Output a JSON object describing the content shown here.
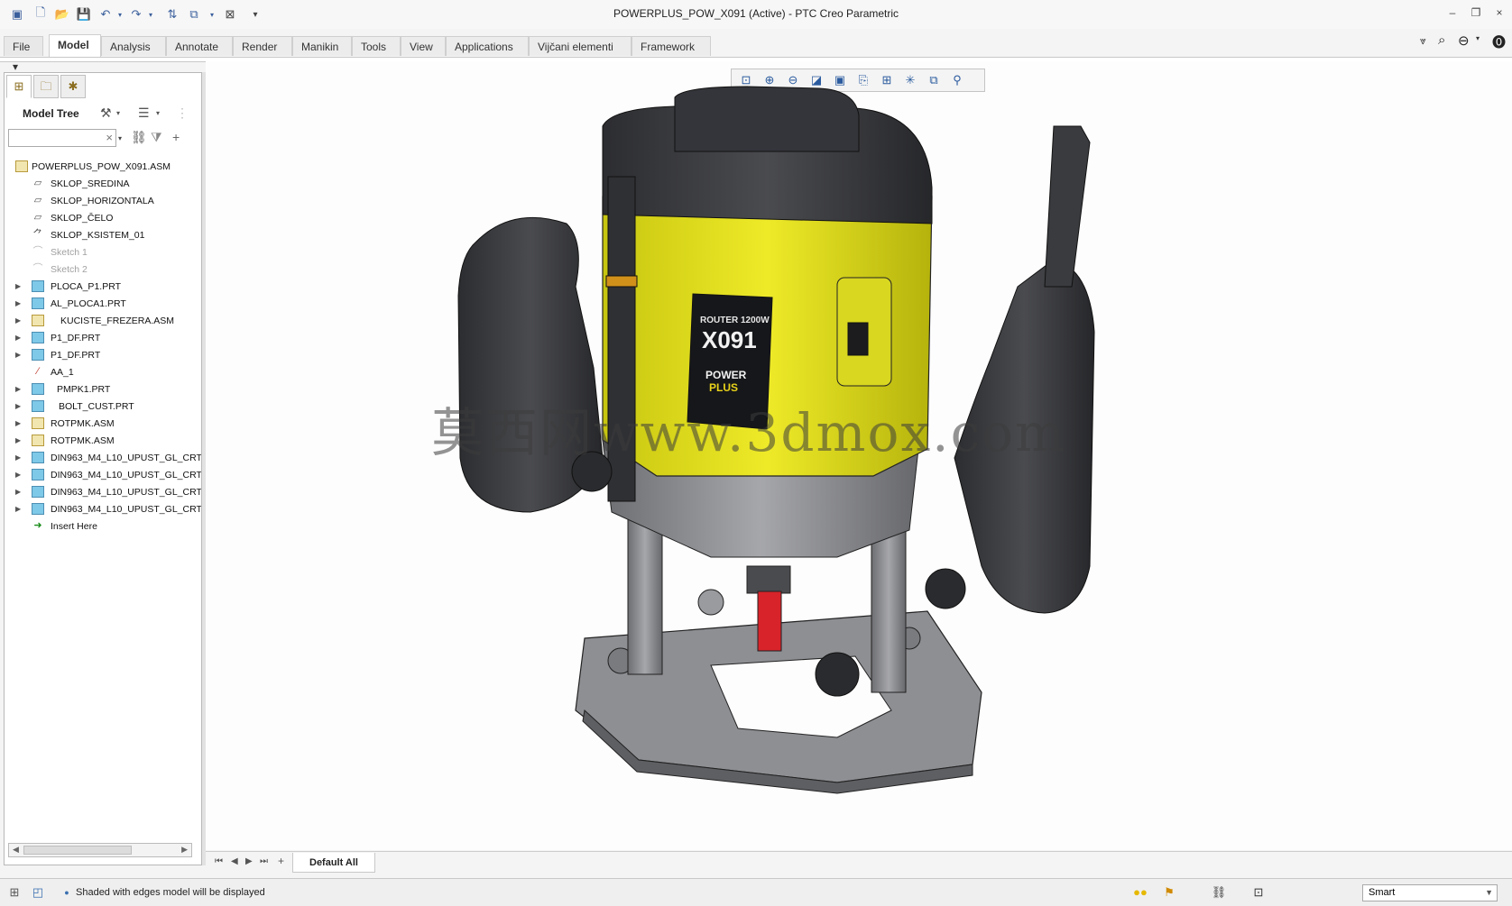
{
  "window": {
    "title": "POWERPLUS_POW_X091 (Active) - PTC Creo Parametric",
    "controls": {
      "minimize": "–",
      "restore": "❐",
      "close": "×"
    }
  },
  "ribbon": {
    "tabs": [
      {
        "label": "File ▾"
      },
      {
        "label": "Model"
      },
      {
        "label": "Analysis"
      },
      {
        "label": "Annotate"
      },
      {
        "label": "Render"
      },
      {
        "label": "Manikin"
      },
      {
        "label": "Tools"
      },
      {
        "label": "View"
      },
      {
        "label": "Applications"
      },
      {
        "label": "Vijčani elementi"
      },
      {
        "label": "Framework"
      }
    ],
    "active_tab": "Model"
  },
  "model_tree": {
    "title": "Model Tree",
    "search_value": "",
    "items": [
      {
        "label": "POWERPLUS_POW_X091.ASM",
        "icon": "assembly-icon",
        "expandable": false
      },
      {
        "label": "SKLOP_SREDINA",
        "icon": "datum-plane-icon",
        "expandable": false
      },
      {
        "label": "SKLOP_HORIZONTALA",
        "icon": "datum-plane-icon",
        "expandable": false
      },
      {
        "label": "SKLOP_ČELO",
        "icon": "datum-plane-icon",
        "expandable": false
      },
      {
        "label": "SKLOP_KSISTEM_01",
        "icon": "csys-icon",
        "expandable": false
      },
      {
        "label": "Sketch 1",
        "icon": "sketch-icon",
        "expandable": false
      },
      {
        "label": "Sketch 2",
        "icon": "sketch-icon",
        "expandable": false
      },
      {
        "label": "PLOCA_P1.PRT",
        "icon": "part-icon",
        "expandable": true
      },
      {
        "label": "AL_PLOCA1.PRT",
        "icon": "part-icon",
        "expandable": true
      },
      {
        "label": "KUCISTE_FREZERA.ASM",
        "icon": "assembly-icon",
        "expandable": true
      },
      {
        "label": "P1_DF.PRT",
        "icon": "part-icon",
        "expandable": true
      },
      {
        "label": "P1_DF.PRT",
        "icon": "part-icon",
        "expandable": true
      },
      {
        "label": "AA_1",
        "icon": "axis-icon",
        "expandable": false
      },
      {
        "label": "PMPK1.PRT",
        "icon": "part-icon",
        "expandable": true
      },
      {
        "label": "BOLT_CUST.PRT",
        "icon": "part-icon",
        "expandable": true
      },
      {
        "label": "ROTPMK.ASM",
        "icon": "assembly-icon",
        "expandable": true
      },
      {
        "label": "ROTPMK.ASM",
        "icon": "assembly-icon",
        "expandable": true
      },
      {
        "label": "DIN963_M4_L10_UPUST_GL_CRT/",
        "icon": "part-icon",
        "expandable": true
      },
      {
        "label": "DIN963_M4_L10_UPUST_GL_CRT/",
        "icon": "part-icon",
        "expandable": true
      },
      {
        "label": "DIN963_M4_L10_UPUST_GL_CRT/",
        "icon": "part-icon",
        "expandable": true
      },
      {
        "label": "DIN963_M4_L10_UPUST_GL_CRT/",
        "icon": "part-icon",
        "expandable": true
      },
      {
        "label": "Insert Here",
        "icon": "insert-arrow-icon",
        "expandable": false
      }
    ]
  },
  "graphics": {
    "watermark": "莫西网www.3dmox.com"
  },
  "bottom_bar": {
    "tab_label": "Default All"
  },
  "status_bar": {
    "message": "Shaded with edges model will be displayed",
    "selection_filter": "Smart"
  },
  "colors": {
    "router_yellow": "#e8e41a",
    "router_dark": "#3a3b3e",
    "base_gray": "#8b8c90",
    "bit_red": "#d8232a"
  }
}
